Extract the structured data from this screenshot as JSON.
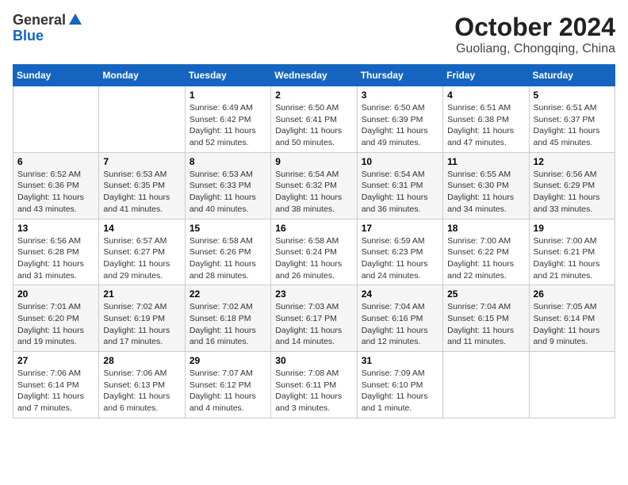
{
  "header": {
    "logo_general": "General",
    "logo_blue": "Blue",
    "month_title": "October 2024",
    "location": "Guoliang, Chongqing, China"
  },
  "days_of_week": [
    "Sunday",
    "Monday",
    "Tuesday",
    "Wednesday",
    "Thursday",
    "Friday",
    "Saturday"
  ],
  "weeks": [
    [
      {
        "day": "",
        "detail": ""
      },
      {
        "day": "",
        "detail": ""
      },
      {
        "day": "1",
        "detail": "Sunrise: 6:49 AM\nSunset: 6:42 PM\nDaylight: 11 hours and 52 minutes."
      },
      {
        "day": "2",
        "detail": "Sunrise: 6:50 AM\nSunset: 6:41 PM\nDaylight: 11 hours and 50 minutes."
      },
      {
        "day": "3",
        "detail": "Sunrise: 6:50 AM\nSunset: 6:39 PM\nDaylight: 11 hours and 49 minutes."
      },
      {
        "day": "4",
        "detail": "Sunrise: 6:51 AM\nSunset: 6:38 PM\nDaylight: 11 hours and 47 minutes."
      },
      {
        "day": "5",
        "detail": "Sunrise: 6:51 AM\nSunset: 6:37 PM\nDaylight: 11 hours and 45 minutes."
      }
    ],
    [
      {
        "day": "6",
        "detail": "Sunrise: 6:52 AM\nSunset: 6:36 PM\nDaylight: 11 hours and 43 minutes."
      },
      {
        "day": "7",
        "detail": "Sunrise: 6:53 AM\nSunset: 6:35 PM\nDaylight: 11 hours and 41 minutes."
      },
      {
        "day": "8",
        "detail": "Sunrise: 6:53 AM\nSunset: 6:33 PM\nDaylight: 11 hours and 40 minutes."
      },
      {
        "day": "9",
        "detail": "Sunrise: 6:54 AM\nSunset: 6:32 PM\nDaylight: 11 hours and 38 minutes."
      },
      {
        "day": "10",
        "detail": "Sunrise: 6:54 AM\nSunset: 6:31 PM\nDaylight: 11 hours and 36 minutes."
      },
      {
        "day": "11",
        "detail": "Sunrise: 6:55 AM\nSunset: 6:30 PM\nDaylight: 11 hours and 34 minutes."
      },
      {
        "day": "12",
        "detail": "Sunrise: 6:56 AM\nSunset: 6:29 PM\nDaylight: 11 hours and 33 minutes."
      }
    ],
    [
      {
        "day": "13",
        "detail": "Sunrise: 6:56 AM\nSunset: 6:28 PM\nDaylight: 11 hours and 31 minutes."
      },
      {
        "day": "14",
        "detail": "Sunrise: 6:57 AM\nSunset: 6:27 PM\nDaylight: 11 hours and 29 minutes."
      },
      {
        "day": "15",
        "detail": "Sunrise: 6:58 AM\nSunset: 6:26 PM\nDaylight: 11 hours and 28 minutes."
      },
      {
        "day": "16",
        "detail": "Sunrise: 6:58 AM\nSunset: 6:24 PM\nDaylight: 11 hours and 26 minutes."
      },
      {
        "day": "17",
        "detail": "Sunrise: 6:59 AM\nSunset: 6:23 PM\nDaylight: 11 hours and 24 minutes."
      },
      {
        "day": "18",
        "detail": "Sunrise: 7:00 AM\nSunset: 6:22 PM\nDaylight: 11 hours and 22 minutes."
      },
      {
        "day": "19",
        "detail": "Sunrise: 7:00 AM\nSunset: 6:21 PM\nDaylight: 11 hours and 21 minutes."
      }
    ],
    [
      {
        "day": "20",
        "detail": "Sunrise: 7:01 AM\nSunset: 6:20 PM\nDaylight: 11 hours and 19 minutes."
      },
      {
        "day": "21",
        "detail": "Sunrise: 7:02 AM\nSunset: 6:19 PM\nDaylight: 11 hours and 17 minutes."
      },
      {
        "day": "22",
        "detail": "Sunrise: 7:02 AM\nSunset: 6:18 PM\nDaylight: 11 hours and 16 minutes."
      },
      {
        "day": "23",
        "detail": "Sunrise: 7:03 AM\nSunset: 6:17 PM\nDaylight: 11 hours and 14 minutes."
      },
      {
        "day": "24",
        "detail": "Sunrise: 7:04 AM\nSunset: 6:16 PM\nDaylight: 11 hours and 12 minutes."
      },
      {
        "day": "25",
        "detail": "Sunrise: 7:04 AM\nSunset: 6:15 PM\nDaylight: 11 hours and 11 minutes."
      },
      {
        "day": "26",
        "detail": "Sunrise: 7:05 AM\nSunset: 6:14 PM\nDaylight: 11 hours and 9 minutes."
      }
    ],
    [
      {
        "day": "27",
        "detail": "Sunrise: 7:06 AM\nSunset: 6:14 PM\nDaylight: 11 hours and 7 minutes."
      },
      {
        "day": "28",
        "detail": "Sunrise: 7:06 AM\nSunset: 6:13 PM\nDaylight: 11 hours and 6 minutes."
      },
      {
        "day": "29",
        "detail": "Sunrise: 7:07 AM\nSunset: 6:12 PM\nDaylight: 11 hours and 4 minutes."
      },
      {
        "day": "30",
        "detail": "Sunrise: 7:08 AM\nSunset: 6:11 PM\nDaylight: 11 hours and 3 minutes."
      },
      {
        "day": "31",
        "detail": "Sunrise: 7:09 AM\nSunset: 6:10 PM\nDaylight: 11 hours and 1 minute."
      },
      {
        "day": "",
        "detail": ""
      },
      {
        "day": "",
        "detail": ""
      }
    ]
  ]
}
